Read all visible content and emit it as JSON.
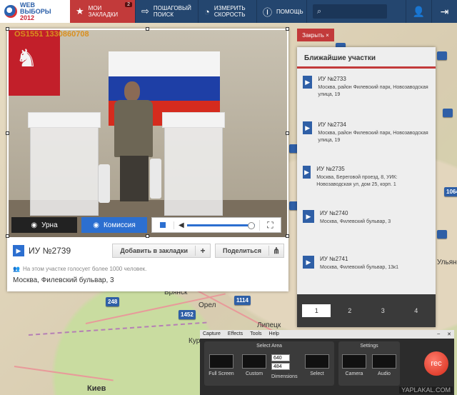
{
  "topbar": {
    "logo_line1": "WEB",
    "logo_line2": "ВЫБОРЫ",
    "logo_line3": "2012",
    "nav": [
      {
        "label": "Мои закладки",
        "icon": "star-icon",
        "badge": "2"
      },
      {
        "label": "Пошаговый поиск",
        "icon": "arrows-icon"
      },
      {
        "label": "Измерить скорость",
        "icon": "speedometer-icon"
      },
      {
        "label": "Помощь",
        "icon": "help-icon"
      }
    ],
    "search_placeholder": ""
  },
  "video": {
    "overlay_text": "OS1551 1330860708",
    "tabs": [
      {
        "label": "Урна",
        "active": false
      },
      {
        "label": "Комиссия",
        "active": true
      }
    ],
    "volume_level": 1.0
  },
  "station": {
    "title": "ИУ №2739",
    "bookmark_label": "Добавить в закладки",
    "bookmark_plus": "+",
    "share_label": "Поделиться",
    "note": "На этом участке голосует более 1000 человек.",
    "address": "Москва, Филевский бульвар, 3"
  },
  "nearby": {
    "close_label": "Закрыть ×",
    "title": "Ближайшие участки",
    "items": [
      {
        "number": "ИУ №2733",
        "address": "Москва, район Филевский парк, Новозаводская улица, 19"
      },
      {
        "number": "ИУ №2734",
        "address": "Москва, район Филевский парк, Новозаводская улица, 19"
      },
      {
        "number": "ИУ №2735",
        "address": "Москва, Береговой проезд, 8, УИК: Новозаводская ул, дом 25, корп. 1"
      },
      {
        "number": "ИУ №2740",
        "address": "Москва, Филевский бульвар, 3"
      },
      {
        "number": "ИУ №2741",
        "address": "Москва, Филевский бульвар, 13к1"
      }
    ],
    "pages": [
      "1",
      "2",
      "3",
      "4"
    ],
    "active_page": "1"
  },
  "map": {
    "markers": [
      "248",
      "1452",
      "1114",
      "1064"
    ],
    "cities": [
      "Брянск",
      "Орел",
      "Курск",
      "Липецк",
      "Киев",
      "Ульяновск"
    ]
  },
  "recorder": {
    "menu": [
      "Capture",
      "Effects",
      "Tools",
      "Help"
    ],
    "select_area_title": "Select Area",
    "settings_title": "Settings",
    "options": [
      "Full Screen",
      "Custom",
      "Dimensions",
      "Select"
    ],
    "width_value": "640",
    "height_value": "484",
    "settings_options": [
      "Camera",
      "Audio"
    ],
    "rec_label": "rec",
    "watermark": "YAPLAKAL.COM"
  },
  "colors": {
    "topbar": "#24466f",
    "accent_red": "#c23a3a",
    "accent_blue": "#2c6fd0"
  }
}
